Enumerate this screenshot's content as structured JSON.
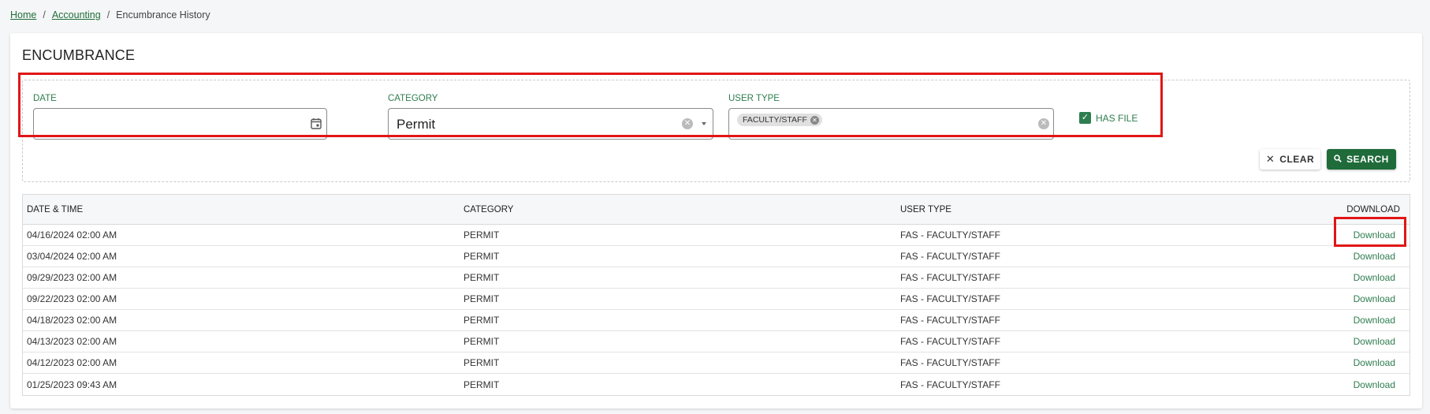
{
  "breadcrumb": {
    "home": "Home",
    "accounting": "Accounting",
    "separator": "/",
    "current": "Encumbrance History"
  },
  "page": {
    "title": "ENCUMBRANCE"
  },
  "filters": {
    "date": {
      "label": "DATE",
      "value": ""
    },
    "category": {
      "label": "CATEGORY",
      "value": "Permit"
    },
    "user_type": {
      "label": "USER TYPE",
      "chip": "FACULTY/STAFF"
    },
    "has_file": {
      "label": "HAS FILE",
      "checked": true
    }
  },
  "buttons": {
    "clear": "CLEAR",
    "search": "SEARCH"
  },
  "table": {
    "headers": {
      "datetime": "DATE & TIME",
      "category": "CATEGORY",
      "user_type": "USER TYPE",
      "download": "DOWNLOAD"
    },
    "rows": [
      {
        "datetime": "04/16/2024 02:00 AM",
        "category": "PERMIT",
        "user_type": "FAS - FACULTY/STAFF",
        "download": "Download"
      },
      {
        "datetime": "03/04/2024 02:00 AM",
        "category": "PERMIT",
        "user_type": "FAS - FACULTY/STAFF",
        "download": "Download"
      },
      {
        "datetime": "09/29/2023 02:00 AM",
        "category": "PERMIT",
        "user_type": "FAS - FACULTY/STAFF",
        "download": "Download"
      },
      {
        "datetime": "09/22/2023 02:00 AM",
        "category": "PERMIT",
        "user_type": "FAS - FACULTY/STAFF",
        "download": "Download"
      },
      {
        "datetime": "04/18/2023 02:00 AM",
        "category": "PERMIT",
        "user_type": "FAS - FACULTY/STAFF",
        "download": "Download"
      },
      {
        "datetime": "04/13/2023 02:00 AM",
        "category": "PERMIT",
        "user_type": "FAS - FACULTY/STAFF",
        "download": "Download"
      },
      {
        "datetime": "04/12/2023 02:00 AM",
        "category": "PERMIT",
        "user_type": "FAS - FACULTY/STAFF",
        "download": "Download"
      },
      {
        "datetime": "01/25/2023 09:43 AM",
        "category": "PERMIT",
        "user_type": "FAS - FACULTY/STAFF",
        "download": "Download"
      }
    ]
  },
  "colors": {
    "accent": "#2e7d4f",
    "search_button": "#1f6b3a",
    "highlight": "#e01616"
  },
  "icons": {
    "calendar": "calendar-icon",
    "clear": "close-icon",
    "search": "search-icon",
    "check": "checkmark-icon",
    "dropdown": "chevron-down-icon"
  }
}
